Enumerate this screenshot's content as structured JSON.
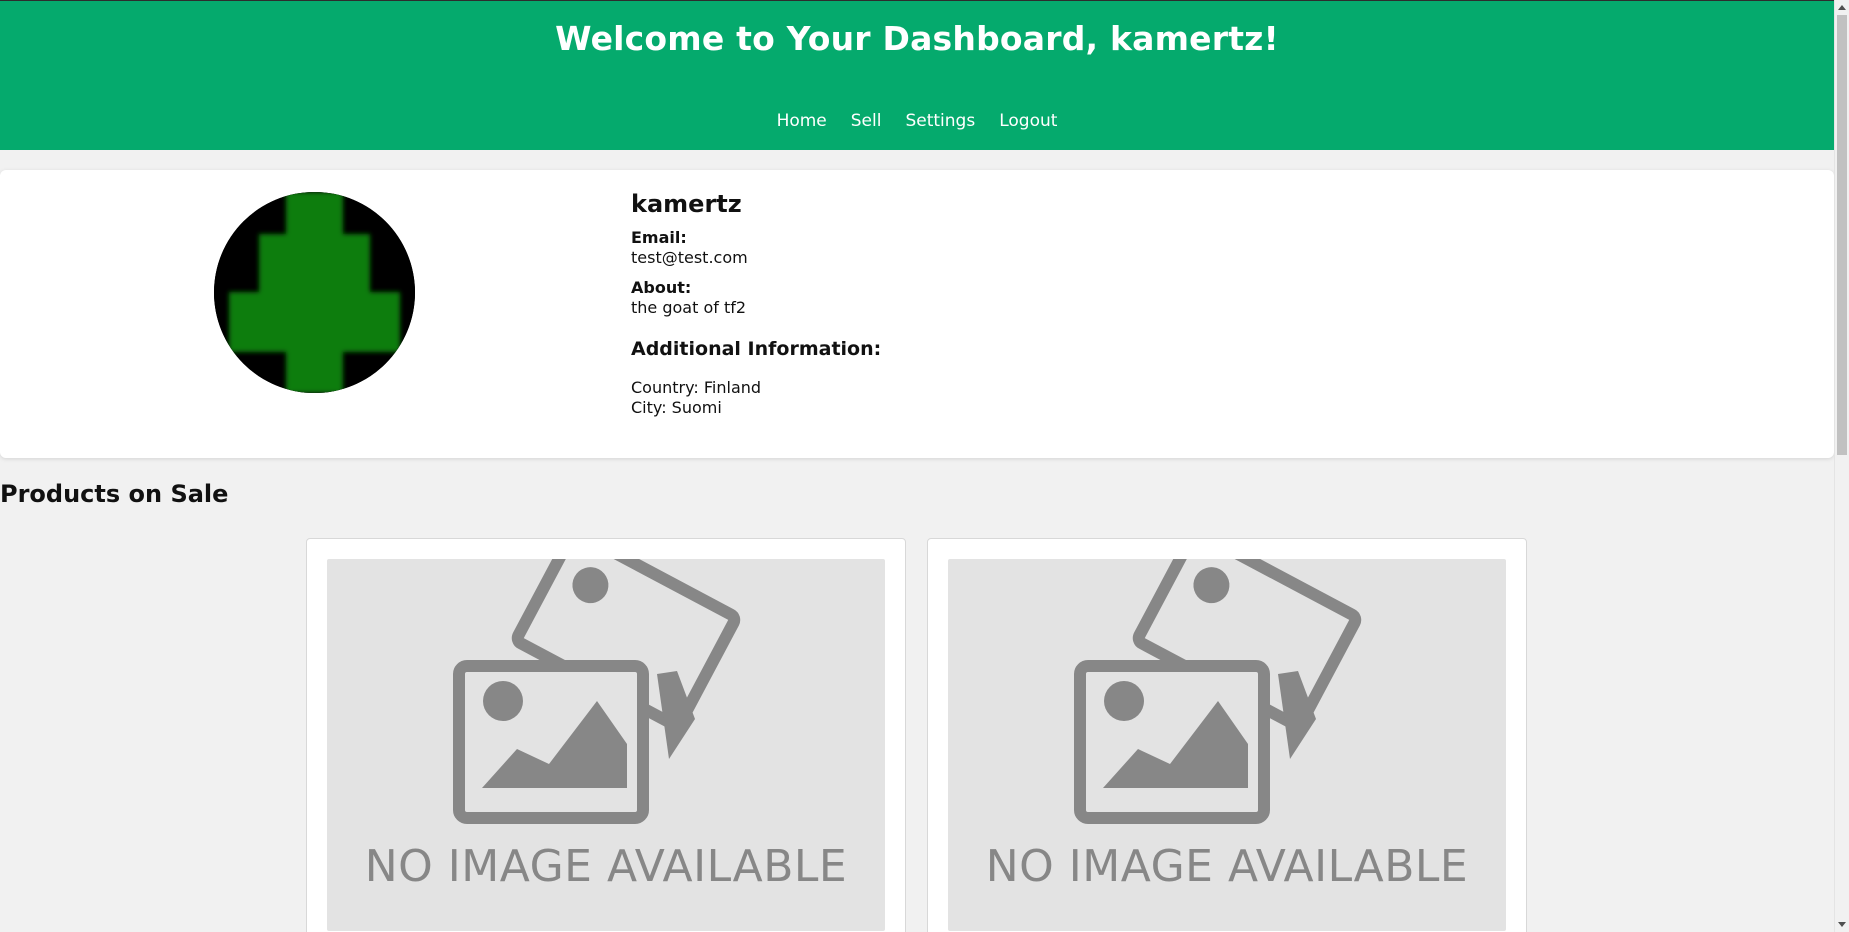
{
  "header": {
    "title": "Welcome to Your Dashboard, kamertz!",
    "nav": [
      "Home",
      "Sell",
      "Settings",
      "Logout"
    ]
  },
  "profile": {
    "username": "kamertz",
    "email_label": "Email:",
    "email": "test@test.com",
    "about_label": "About:",
    "about": "the goat of tf2",
    "additional_title": "Additional Information:",
    "country_line": "Country: Finland",
    "city_line": "City: Suomi",
    "avatar_icon": "green-pixel-tree-avatar"
  },
  "products": {
    "section_title": "Products on Sale",
    "items": [
      {
        "image_text": "NO IMAGE AVAILABLE",
        "image_icon": "no-image-placeholder-icon"
      },
      {
        "image_text": "NO IMAGE AVAILABLE",
        "image_icon": "no-image-placeholder-icon"
      }
    ]
  },
  "colors": {
    "header_bg": "#05aa6d",
    "page_bg": "#f1f1f1",
    "placeholder_bg": "#e3e3e3",
    "placeholder_fg": "#878787",
    "avatar_green": "#0a7a0a"
  }
}
